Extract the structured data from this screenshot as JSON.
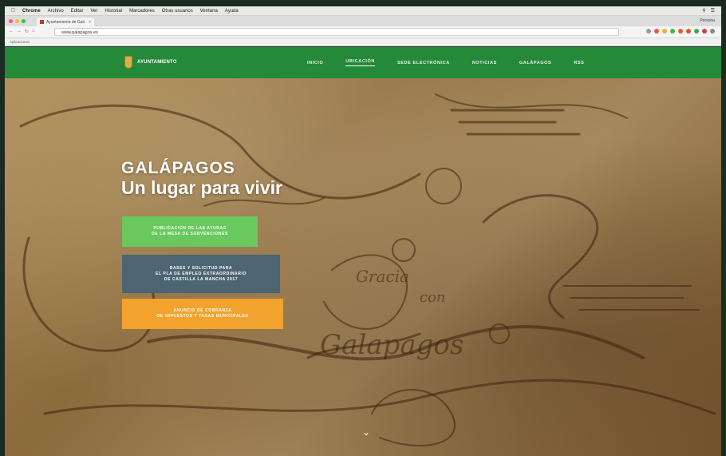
{
  "menubar": {
    "app": "Chrome",
    "items": [
      "Archivo",
      "Editar",
      "Ver",
      "Historial",
      "Marcadores",
      "Otras usuarios",
      "Ventana",
      "Ayuda"
    ]
  },
  "browser": {
    "tab_title": "Ayuntamiento de Galápagos",
    "user": "Persona",
    "url": "www.galapagos.es",
    "bookmarks": "Aplicaciones"
  },
  "site": {
    "logo_text": "AYUNTAMIENTO",
    "nav": [
      "INICIO",
      "UBICACIÓN",
      "SEDE ELECTRÓNICA",
      "NOTICIAS",
      "GALÁPAGOS",
      "RSS"
    ],
    "active_nav": "UBICACIÓN"
  },
  "hero": {
    "title_line1": "GALÁPAGOS",
    "title_line2": "Un lugar para vivir",
    "cta1_l1": "PUBLICACIÓN DE LAS AYUDAS",
    "cta1_l2": "DE LA MESA DE SUBVENCIONES",
    "cta2_l1": "BASES Y SOLICITUD PARA",
    "cta2_l2": "EL PLA DE EMPLEO EXTRAORDINARIO",
    "cta2_l3": "DE CASTILLA LA MANCHA 2017",
    "cta3_l1": "ANUNCIO DE COBRANZA",
    "cta3_l2": "DE IMPUESTOS Y TASAS MUNICIPALES",
    "scroll_icon": "chevron-down-icon"
  },
  "colors": {
    "nav_green": "#248a39",
    "cta_green": "#69c95e",
    "cta_slate": "#4d6472",
    "cta_orange": "#f2a32d"
  }
}
